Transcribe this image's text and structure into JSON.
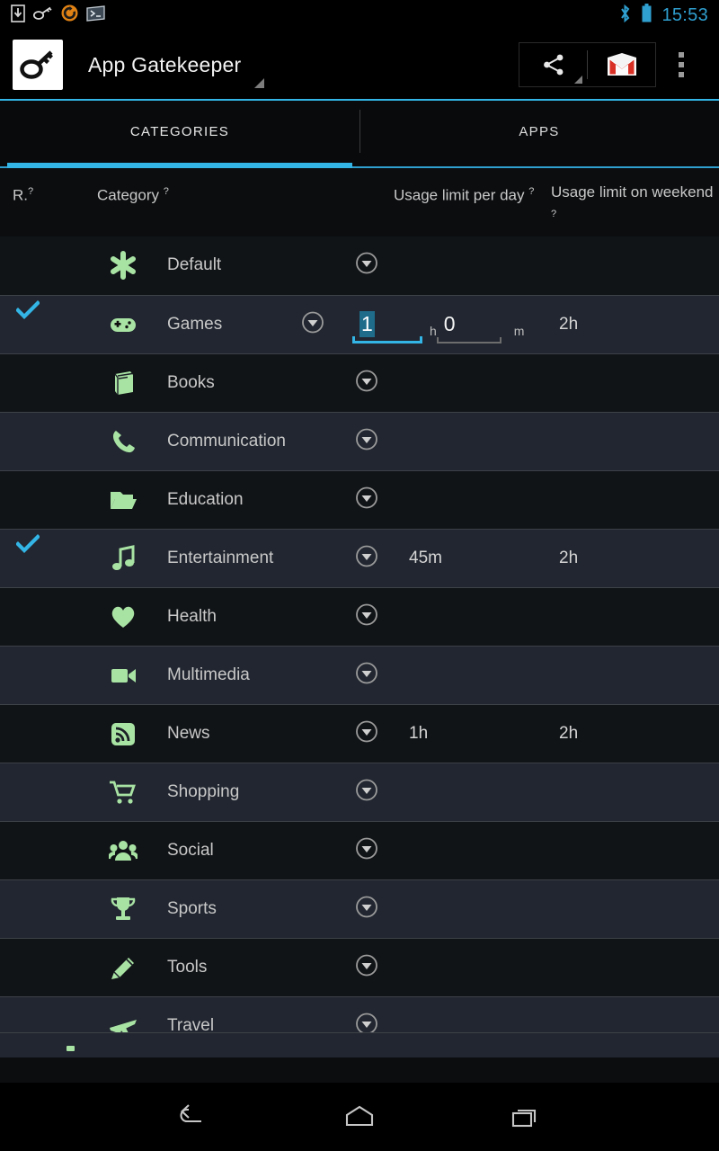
{
  "statusbar": {
    "icons": [
      "download-icon",
      "vpn-key-icon",
      "sync-icon",
      "terminal-icon"
    ],
    "bluetooth_icon": "bluetooth-icon",
    "battery_icon": "battery-icon",
    "time": "15:53",
    "accent_color": "#2f9fd0"
  },
  "actionbar": {
    "logo_icon": "app-key-logo-icon",
    "title": "App Gatekeeper",
    "share_icon": "share-icon",
    "gmail_icon": "gmail-icon",
    "overflow_icon": "overflow-menu-icon",
    "accent_color": "#33b5e5"
  },
  "tabs": {
    "items": [
      {
        "label": "CATEGORIES",
        "active": true
      },
      {
        "label": "APPS",
        "active": false
      }
    ],
    "indicator_color": "#33b5e5"
  },
  "table": {
    "headers": {
      "r": "R.",
      "r_help": "?",
      "category": "Category",
      "category_help": "?",
      "usage_day": "Usage limit per day",
      "usage_day_help": "?",
      "usage_weekend": "Usage limit on weekend",
      "usage_weekend_help": "?"
    },
    "dropdown_icon": "chevron-down-circle-icon",
    "check_icon": "check-icon",
    "icon_color": "#a9e3a4",
    "rows": [
      {
        "name": "Default",
        "icon": "asterisk-icon",
        "checked": false,
        "day": "",
        "weekend": "",
        "editing": false
      },
      {
        "name": "Games",
        "icon": "gamepad-icon",
        "checked": true,
        "day": "",
        "weekend": "2h",
        "editing": true,
        "edit": {
          "hours": "1",
          "hours_unit": "h",
          "minutes": "0",
          "minutes_unit": "m"
        }
      },
      {
        "name": "Books",
        "icon": "book-icon",
        "checked": false,
        "day": "",
        "weekend": "",
        "editing": false
      },
      {
        "name": "Communication",
        "icon": "phone-icon",
        "checked": false,
        "day": "",
        "weekend": "",
        "editing": false
      },
      {
        "name": "Education",
        "icon": "folder-open-icon",
        "checked": false,
        "day": "",
        "weekend": "",
        "editing": false
      },
      {
        "name": "Entertainment",
        "icon": "music-note-icon",
        "checked": true,
        "day": "45m",
        "weekend": "2h",
        "editing": false
      },
      {
        "name": "Health",
        "icon": "heart-icon",
        "checked": false,
        "day": "",
        "weekend": "",
        "editing": false
      },
      {
        "name": "Multimedia",
        "icon": "video-camera-icon",
        "checked": false,
        "day": "",
        "weekend": "",
        "editing": false
      },
      {
        "name": "News",
        "icon": "rss-feed-icon",
        "checked": false,
        "day": "1h",
        "weekend": "2h",
        "editing": false
      },
      {
        "name": "Shopping",
        "icon": "shopping-cart-icon",
        "checked": false,
        "day": "",
        "weekend": "",
        "editing": false
      },
      {
        "name": "Social",
        "icon": "people-group-icon",
        "checked": false,
        "day": "",
        "weekend": "",
        "editing": false
      },
      {
        "name": "Sports",
        "icon": "trophy-icon",
        "checked": false,
        "day": "",
        "weekend": "",
        "editing": false
      },
      {
        "name": "Tools",
        "icon": "pencil-icon",
        "checked": false,
        "day": "",
        "weekend": "",
        "editing": false
      },
      {
        "name": "Travel",
        "icon": "airplane-icon",
        "checked": false,
        "day": "",
        "weekend": "",
        "editing": false
      }
    ]
  },
  "navbar": {
    "back_icon": "back-icon",
    "home_icon": "home-icon",
    "recents_icon": "recents-icon"
  }
}
